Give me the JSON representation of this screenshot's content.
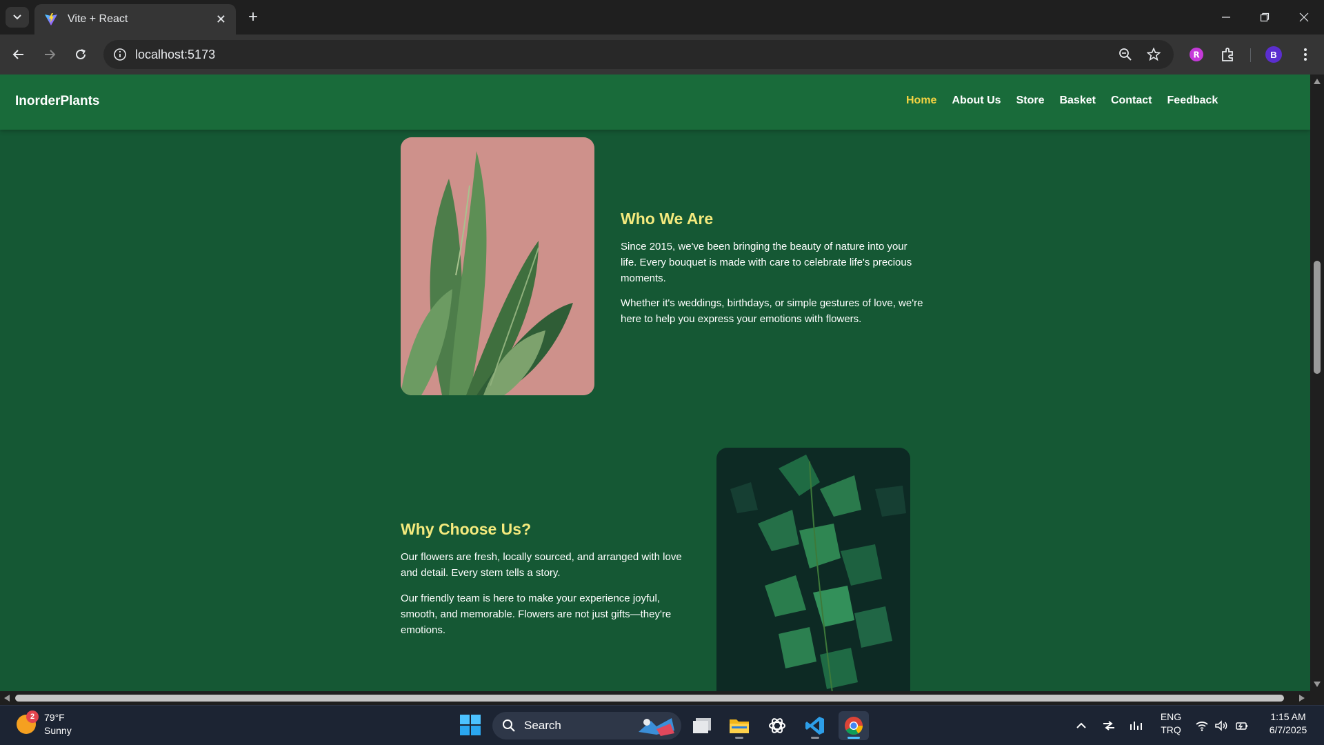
{
  "browser": {
    "tab_title": "Vite + React",
    "url": "localhost:5173"
  },
  "site": {
    "brand": "InorderPlants",
    "nav": [
      {
        "label": "Home",
        "active": true
      },
      {
        "label": "About Us",
        "active": false
      },
      {
        "label": "Store",
        "active": false
      },
      {
        "label": "Basket",
        "active": false
      },
      {
        "label": "Contact",
        "active": false
      },
      {
        "label": "Feedback",
        "active": false
      }
    ],
    "sections": [
      {
        "title": "Who We Are",
        "paragraphs": [
          "Since 2015, we've been bringing the beauty of nature into your life. Every bouquet is made with care to celebrate life's precious moments.",
          "Whether it's weddings, birthdays, or simple gestures of love, we're here to help you express your emotions with flowers."
        ]
      },
      {
        "title": "Why Choose Us?",
        "paragraphs": [
          "Our flowers are fresh, locally sourced, and arranged with love and detail. Every stem tells a story.",
          "Our friendly team is here to make your experience joyful, smooth, and memorable. Flowers are not just gifts—they're emotions."
        ]
      }
    ]
  },
  "taskbar": {
    "weather_badge": "2",
    "weather_temp": "79°F",
    "weather_desc": "Sunny",
    "search_label": "Search",
    "lang_primary": "ENG",
    "lang_secondary": "TRQ",
    "time": "1:15 AM",
    "date": "6/7/2025"
  },
  "colors": {
    "page_bg": "#155834",
    "header_bg": "#196b3a",
    "heading": "#f4ea7d",
    "nav_active": "#f5d442"
  }
}
